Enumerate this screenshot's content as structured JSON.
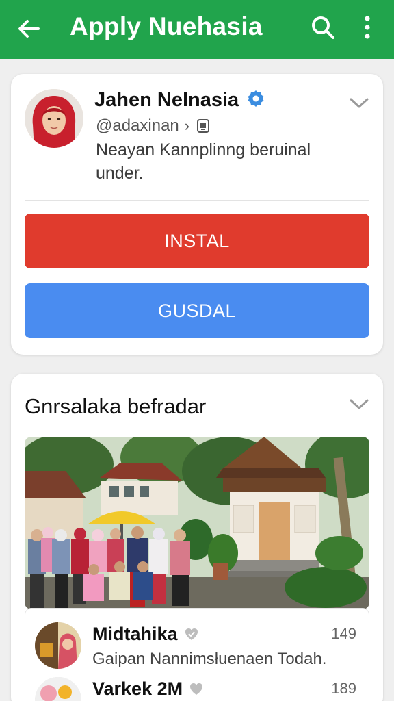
{
  "appbar": {
    "title": "Apply Nuehasia",
    "color": "#21a44c",
    "back_icon": "arrow-left-icon",
    "search_icon": "search-icon",
    "more_icon": "more-vert-icon"
  },
  "profile": {
    "name": "Jahen Nelnasia",
    "verified_icon": "verified-badge-icon",
    "handle": "@adaxinan",
    "handle_chevron": "›",
    "description": "Neayan Kannplinng beruinal under."
  },
  "actions": {
    "install_label": "INSTAL",
    "install_color": "#e03b2d",
    "secondary_label": "GUSDAL",
    "secondary_color": "#4a8cf0"
  },
  "section": {
    "title": "Gnrsalaka befradar"
  },
  "list": [
    {
      "name": "Midtahika",
      "subtitle": "Gaipan Nannimsłuenaen Todah.",
      "count": "149"
    },
    {
      "name": "Varkek 2M",
      "subtitle": "",
      "count": "189"
    }
  ]
}
